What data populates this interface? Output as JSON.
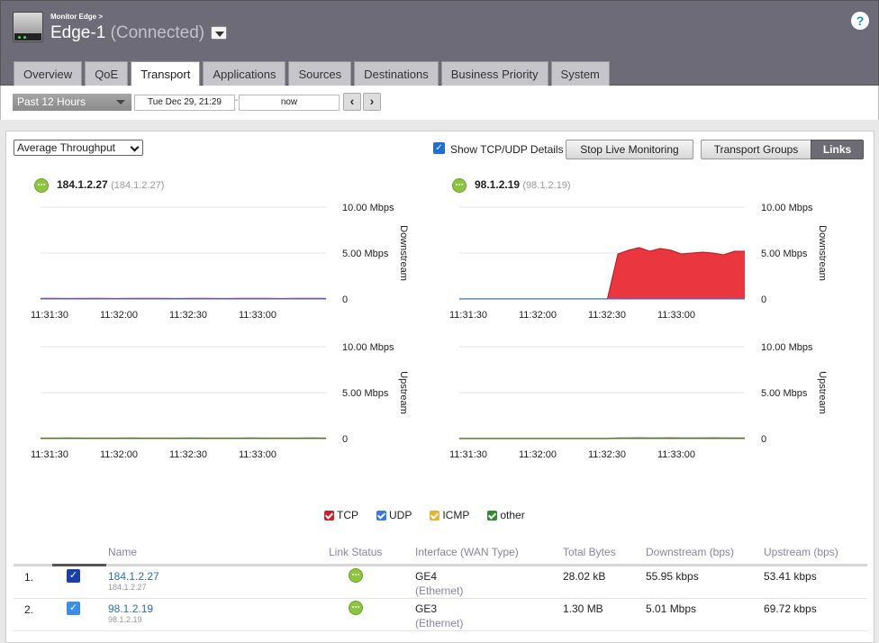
{
  "header": {
    "breadcrumb": "Monitor Edge >",
    "edge_name": "Edge-1",
    "status": "(Connected)",
    "help": "?"
  },
  "tabs": [
    "Overview",
    "QoE",
    "Transport",
    "Applications",
    "Sources",
    "Destinations",
    "Business Priority",
    "System"
  ],
  "active_tab": "Transport",
  "time_range": {
    "preset": "Past 12 Hours",
    "start": "Tue Dec 29, 21:29",
    "separator": "-",
    "end": "now",
    "prev_icon": "chevron-left-icon",
    "next_icon": "chevron-right-icon"
  },
  "toolbar": {
    "metric": "Average Throughput",
    "show_details_label": "Show TCP/UDP Details",
    "show_details_checked": true,
    "stop_label": "Stop Live Monitoring",
    "groups_label": "Transport Groups",
    "links_label": "Links"
  },
  "links": [
    {
      "name": "184.1.2.27",
      "ip": "(184.1.2.27)"
    },
    {
      "name": "98.1.2.19",
      "ip": "(98.1.2.19)"
    }
  ],
  "chart_data": [
    {
      "type": "area",
      "link": "184.1.2.27",
      "direction": "Downstream",
      "x_ticks": [
        "11:31:30",
        "11:32:00",
        "11:32:30",
        "11:33:00"
      ],
      "y_ticks": [
        "10.00 Mbps",
        "5.00 Mbps",
        "0"
      ],
      "ylim": [
        0,
        10
      ],
      "series": [
        {
          "name": "TCP",
          "color": "#e8202a",
          "values": [
            0.06,
            0.06,
            0.05,
            0.06,
            0.06,
            0.05,
            0.06,
            0.06,
            0.06,
            0.05,
            0.06,
            0.06,
            0.05,
            0.06,
            0.06,
            0.06,
            0.05,
            0.06,
            0.06,
            0.06
          ]
        },
        {
          "name": "UDP",
          "color": "#3b6fe0",
          "values": [
            0.01,
            0.01,
            0.01,
            0.01,
            0.01,
            0.01,
            0.01,
            0.01,
            0.01,
            0.01,
            0.01,
            0.01,
            0.01,
            0.01,
            0.01,
            0.01,
            0.01,
            0.01,
            0.01,
            0.01
          ]
        }
      ]
    },
    {
      "type": "area",
      "link": "98.1.2.19",
      "direction": "Downstream",
      "x_ticks": [
        "11:31:30",
        "11:32:00",
        "11:32:30",
        "11:33:00"
      ],
      "y_ticks": [
        "10.00 Mbps",
        "5.00 Mbps",
        "0"
      ],
      "ylim": [
        0,
        10
      ],
      "series": [
        {
          "name": "TCP",
          "color": "#e8202a",
          "values": [
            0,
            0,
            0,
            0,
            0,
            0,
            0,
            0,
            0,
            0,
            0,
            0,
            0,
            0,
            0,
            4.9,
            5.3,
            5.6,
            5.2,
            5.5,
            5.3,
            4.9,
            5.0,
            5.1,
            5.0,
            4.8,
            5.2,
            5.2
          ]
        },
        {
          "name": "UDP",
          "color": "#3b6fe0",
          "values": [
            0.01,
            0.01,
            0.01,
            0.01,
            0.01,
            0.01,
            0.01,
            0.01,
            0.01,
            0.01,
            0.01,
            0.01,
            0.01,
            0.01,
            0.01,
            0.01,
            0.01,
            0.01,
            0.01,
            0.01,
            0.01,
            0.01,
            0.01,
            0.01,
            0.01,
            0.01,
            0.01,
            0.01
          ]
        }
      ]
    },
    {
      "type": "area",
      "link": "184.1.2.27",
      "direction": "Upstream",
      "x_ticks": [
        "11:31:30",
        "11:32:00",
        "11:32:30",
        "11:33:00"
      ],
      "y_ticks": [
        "10.00 Mbps",
        "5.00 Mbps",
        "0"
      ],
      "ylim": [
        0,
        10
      ],
      "series": [
        {
          "name": "TCP",
          "color": "#e8202a",
          "values": [
            0.05,
            0.05,
            0.06,
            0.05,
            0.05,
            0.05,
            0.06,
            0.05,
            0.05,
            0.05,
            0.06,
            0.05,
            0.05,
            0.05,
            0.06,
            0.05,
            0.05,
            0.05,
            0.06,
            0.05
          ]
        },
        {
          "name": "other",
          "color": "#2e8b2e",
          "values": [
            0.02,
            0.02,
            0.02,
            0.02,
            0.02,
            0.02,
            0.02,
            0.02,
            0.02,
            0.02,
            0.02,
            0.02,
            0.02,
            0.02,
            0.02,
            0.02,
            0.02,
            0.02,
            0.02,
            0.02
          ]
        }
      ]
    },
    {
      "type": "area",
      "link": "98.1.2.19",
      "direction": "Upstream",
      "x_ticks": [
        "11:31:30",
        "11:32:00",
        "11:32:30",
        "11:33:00"
      ],
      "y_ticks": [
        "10.00 Mbps",
        "5.00 Mbps",
        "0"
      ],
      "ylim": [
        0,
        10
      ],
      "series": [
        {
          "name": "TCP",
          "color": "#e8202a",
          "values": [
            0,
            0,
            0,
            0,
            0,
            0,
            0,
            0,
            0,
            0,
            0,
            0,
            0,
            0,
            0,
            0.07,
            0.07,
            0.08,
            0.07,
            0.07,
            0.08,
            0.07,
            0.07,
            0.07,
            0.08,
            0.07,
            0.07,
            0.07
          ]
        },
        {
          "name": "other",
          "color": "#2e8b2e",
          "values": [
            0.02,
            0.02,
            0.02,
            0.02,
            0.02,
            0.02,
            0.02,
            0.02,
            0.02,
            0.02,
            0.02,
            0.02,
            0.02,
            0.02,
            0.02,
            0.02,
            0.02,
            0.02,
            0.02,
            0.02,
            0.02,
            0.02,
            0.02,
            0.02,
            0.02,
            0.02,
            0.02,
            0.02
          ]
        }
      ]
    }
  ],
  "legend": [
    {
      "label": "TCP",
      "color": "#c8232c"
    },
    {
      "label": "UDP",
      "color": "#3a7bd5"
    },
    {
      "label": "ICMP",
      "color": "#e8b230"
    },
    {
      "label": "other",
      "color": "#2e8b2e"
    }
  ],
  "table": {
    "headers": {
      "name": "Name",
      "status": "Link Status",
      "interface": "Interface (WAN Type)",
      "total": "Total Bytes",
      "down": "Downstream (bps)",
      "up": "Upstream (bps)"
    },
    "rows": [
      {
        "index": "1.",
        "checked": true,
        "name": "184.1.2.27",
        "sub": "184.1.2.27",
        "interface": "GE4",
        "wan_type": "(Ethernet)",
        "total": "28.02 kB",
        "down": "55.95 kbps",
        "up": "53.41 kbps",
        "check_color": "#1b3fa8"
      },
      {
        "index": "2.",
        "checked": true,
        "name": "98.1.2.19",
        "sub": "98.1.2.19",
        "interface": "GE3",
        "wan_type": "(Ethernet)",
        "total": "1.30 MB",
        "down": "5.01 Mbps",
        "up": "69.72 kbps",
        "check_color": "#3a8ee6"
      }
    ]
  }
}
